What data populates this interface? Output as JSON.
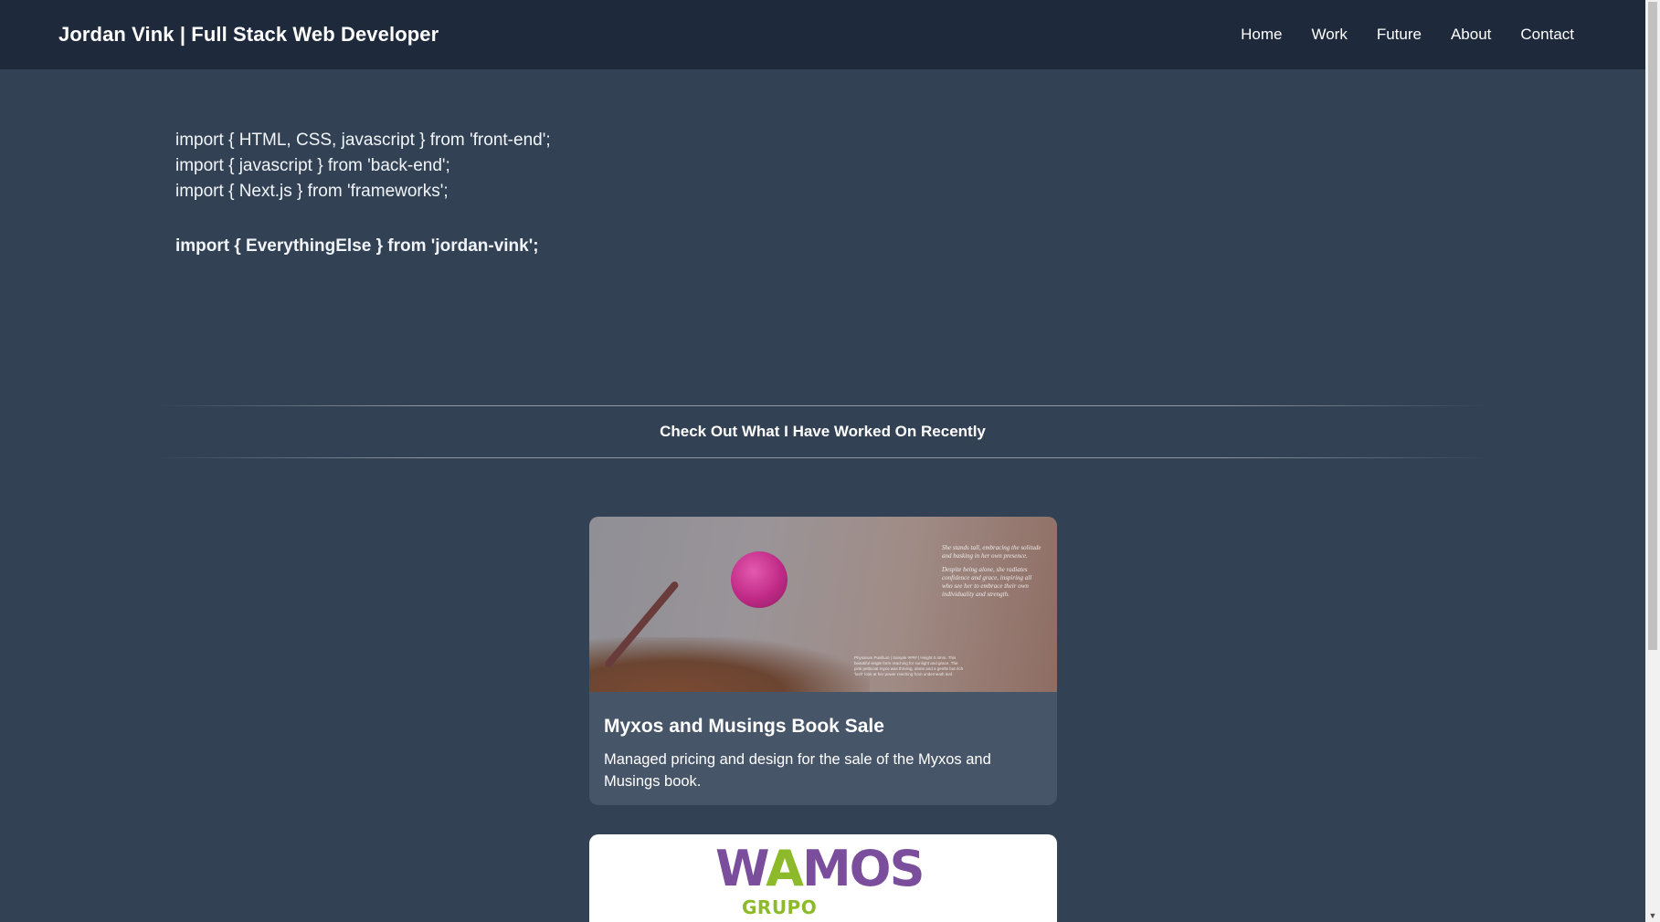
{
  "header": {
    "brand": "Jordan Vink | Full Stack Web Developer",
    "nav": [
      "Home",
      "Work",
      "Future",
      "About",
      "Contact"
    ]
  },
  "hero": {
    "lines": [
      "import { HTML, CSS, javascript } from 'front-end';",
      "import { javascript } from 'back-end';",
      "import { Next.js } from 'frameworks';"
    ],
    "emphasis": "import { EverythingElse } from 'jordan-vink';"
  },
  "section": {
    "title": "Check Out What I Have Worked On Recently"
  },
  "projects": [
    {
      "title": "Myxos and Musings Book Sale",
      "description": "Managed pricing and design for the sale of the Myxos and Musings book.",
      "image": {
        "poem_1": "She stands tall, embracing the solitude and basking in her own presence.",
        "poem_2": "Despite being alone, she radiates confidence and grace, inspiring all who see her to embrace their own individuality and strength.",
        "caption": "Physarum Pusillum | Sample #### | Height 0.4mm. This beautiful single form reaching for sunlight and grace. The pink petticoat myxo was thriving, alone and a gentle but rich 'lush' look at her power reaching from underneath leaf."
      }
    },
    {
      "logo_main_w": "W",
      "logo_main_a": "A",
      "logo_main_rest": "MOS",
      "logo_sub": "GRUPO"
    }
  ],
  "colors": {
    "header_bg": "#1e293b",
    "page_bg": "#334155",
    "card_bg": "#475569",
    "logo_purple": "#7a4e9c",
    "logo_green": "#8cba2a"
  }
}
